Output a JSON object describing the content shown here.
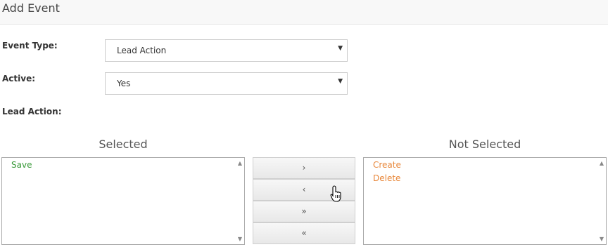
{
  "header": {
    "title": "Add Event"
  },
  "form": {
    "event_type": {
      "label": "Event Type:",
      "value": "Lead Action"
    },
    "active": {
      "label": "Active:",
      "value": "Yes"
    },
    "lead_action": {
      "label": "Lead Action:"
    }
  },
  "selected": {
    "heading": "Selected",
    "items": [
      "Save"
    ],
    "item_color": "#3a9a3a"
  },
  "not_selected": {
    "heading": "Not Selected",
    "items": [
      "Create",
      "Delete"
    ],
    "item_color": "#e8873a"
  },
  "buttons": {
    "move_right": "›",
    "move_left": "‹",
    "move_all_right": "»",
    "move_all_left": "«"
  },
  "icons": {
    "caret": "▼",
    "scroll_up": "▲",
    "scroll_down": "▼"
  }
}
